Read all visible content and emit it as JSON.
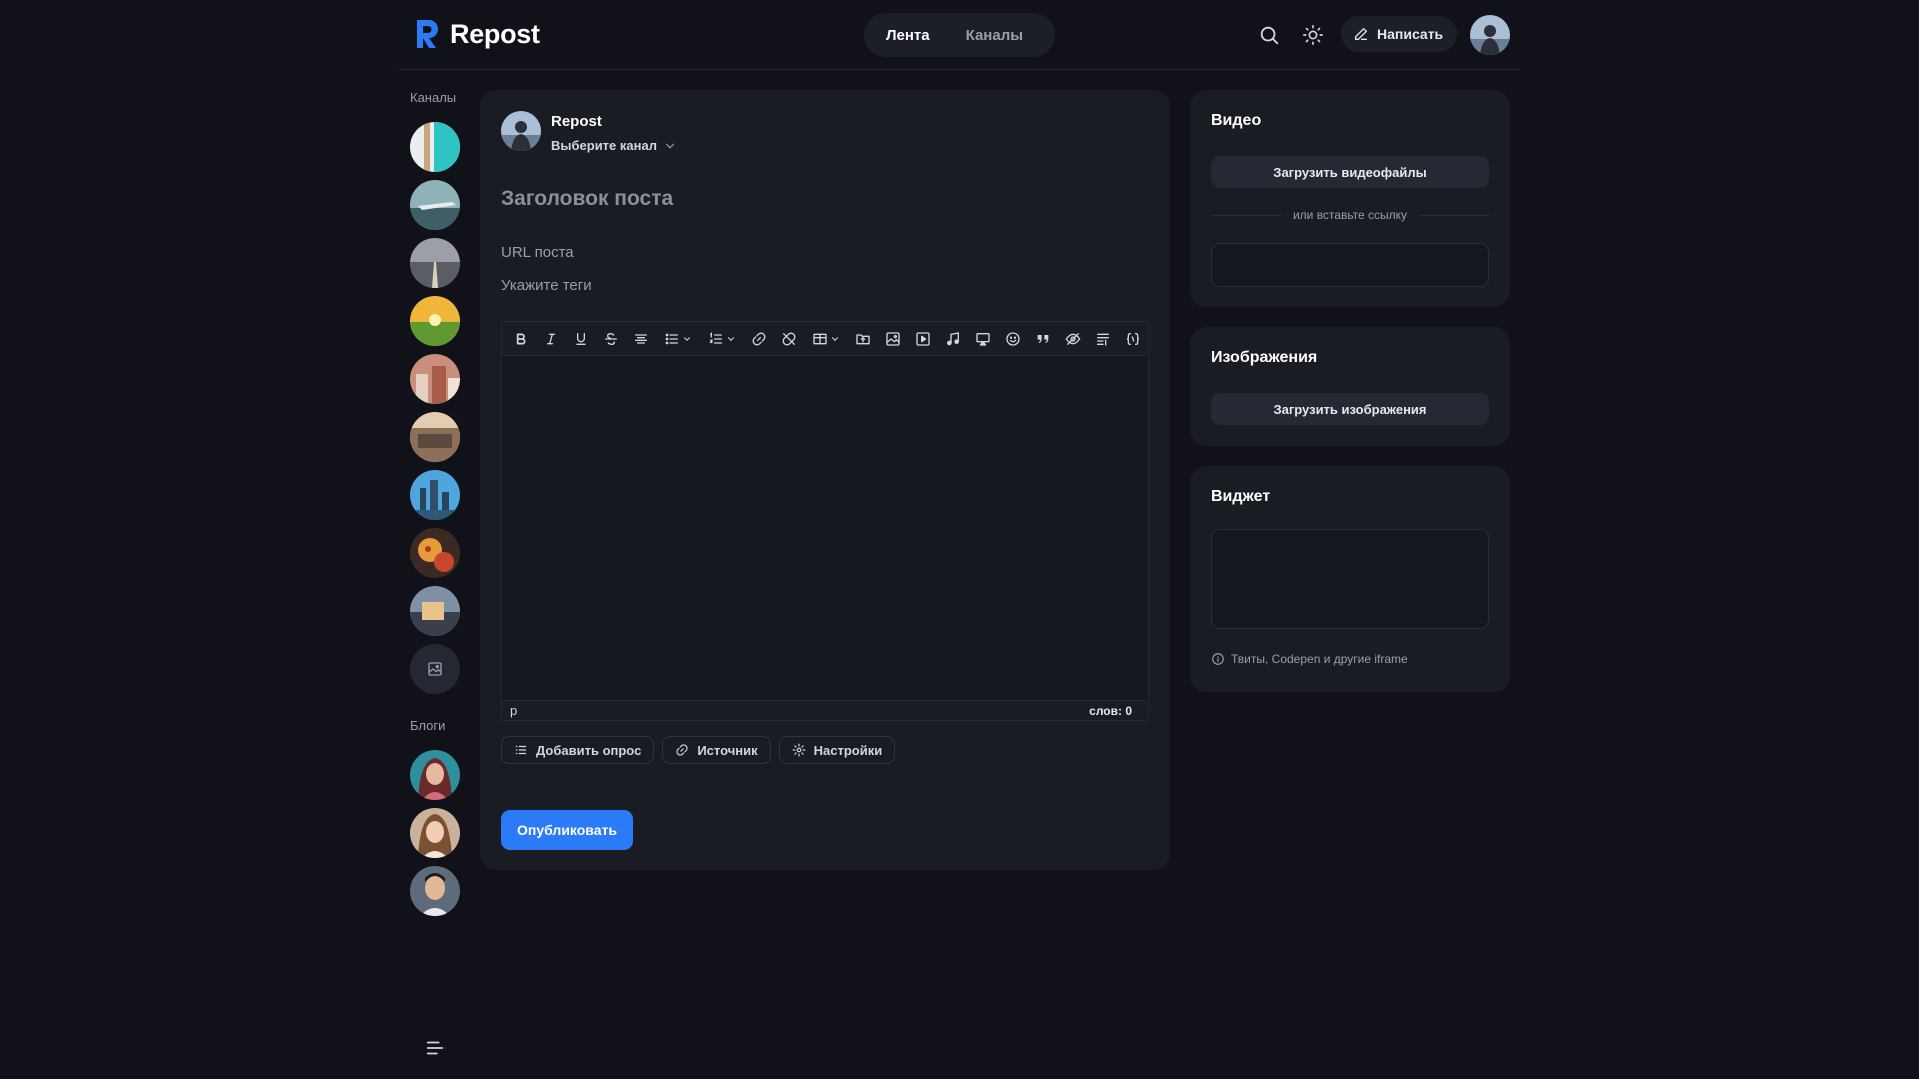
{
  "header": {
    "brand": "Repost",
    "nav": [
      {
        "label": "Лента",
        "active": true
      },
      {
        "label": "Каналы",
        "active": false
      }
    ],
    "write_label": "Написать"
  },
  "sidebar": {
    "channels_label": "Каналы",
    "blogs_label": "Блоги"
  },
  "editor": {
    "author_name": "Repost",
    "channel_select": "Выберите канал",
    "title_placeholder": "Заголовок поста",
    "url_placeholder": "URL поста",
    "tags_placeholder": "Укажите теги",
    "status_path": "p",
    "word_count": "слов: 0",
    "extras": {
      "poll": "Добавить опрос",
      "source": "Источник",
      "settings": "Настройки"
    },
    "publish": "Опубликовать"
  },
  "widgets": {
    "video": {
      "title": "Видео",
      "upload": "Загрузить видеофайлы",
      "or_paste": "или вставьте ссылку"
    },
    "images": {
      "title": "Изображения",
      "upload": "Загрузить изображения"
    },
    "widget": {
      "title": "Виджет",
      "hint": "Твиты, Codepen и другие iframe"
    }
  },
  "colors": {
    "background": "#111219",
    "card": "#1a1c24",
    "accent": "#2c7bf6"
  }
}
